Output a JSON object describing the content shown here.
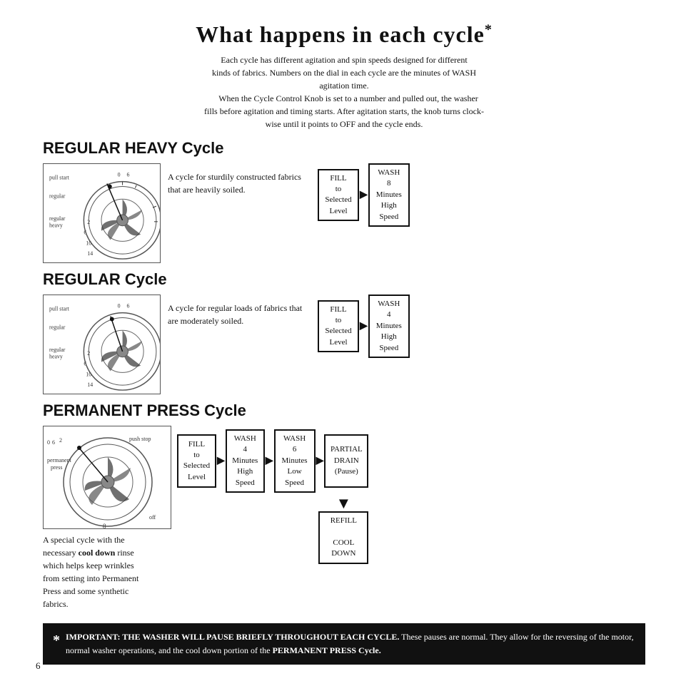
{
  "page": {
    "title": "What happens in each cycle",
    "title_sup": "*",
    "intro": [
      "Each cycle has different agitation and spin speeds designed for different",
      "kinds of fabrics. Numbers on the dial in each cycle are the minutes of WASH",
      "agitation time.",
      "When the Cycle Control Knob is set to a number and pulled out, the washer",
      "fills before agitation and timing starts. After agitation starts, the knob turns clock-",
      "wise until it points to OFF and the cycle ends."
    ],
    "page_number": "6"
  },
  "cycles": [
    {
      "id": "regular-heavy",
      "title": "REGULAR HEAVY Cycle",
      "description": "A cycle for sturdily constructed fabrics that are heavily soiled.",
      "flow": [
        {
          "label": "FILL\nto\nSelected\nLevel"
        },
        {
          "arrow": true
        },
        {
          "label": "WASH\n8\nMinutes\nHigh\nSpeed"
        }
      ]
    },
    {
      "id": "regular",
      "title": "REGULAR Cycle",
      "description": "A cycle for regular loads of fabrics that are moderately soiled.",
      "flow": [
        {
          "label": "FILL\nto\nSelected\nLevel"
        },
        {
          "arrow": true
        },
        {
          "label": "WASH\n4\nMinutes\nHigh\nSpeed"
        }
      ]
    }
  ],
  "perm_press": {
    "title": "PERMANENT PRESS Cycle",
    "description": "A special cycle with the necessary cool down rinse which helps keep wrinkles from setting into Permanent Press and some synthetic fabrics.",
    "description_bold": "cool down",
    "flow_top": [
      {
        "label": "FILL\nto\nSelected\nLevel"
      },
      {
        "arrow": true
      },
      {
        "label": "WASH\n4\nMinutes\nHigh\nSpeed"
      },
      {
        "arrow": true
      },
      {
        "label": "WASH\n6\nMinutes\nLow\nSpeed"
      },
      {
        "arrow": true
      },
      {
        "label": "PARTIAL\nDRAIN\n(Pause)"
      }
    ],
    "flow_bottom": {
      "label": "REFILL\n\nCOOL\nDOWN"
    }
  },
  "important": {
    "asterisk": "*",
    "text_bold": "IMPORTANT: THE WASHER WILL PAUSE BRIEFLY THROUGHOUT EACH CYCLE.",
    "text_normal": " These pauses are normal. They allow for the reversing of the motor, normal washer operations, and the cool down portion of the PERMANENT PRESS Cycle."
  },
  "labels": {
    "fill_to": "FILL\nto",
    "selected_level": "Selected\nLevel",
    "wash_8_high": "WASH\n8\nMinutes\nHigh\nSpeed",
    "wash_4_high": "WASH\n4\nMinutes\nHigh\nSpeed",
    "wash_4_high_pp": "WASH\n4\nMinutes\nHigh\nSpeed",
    "wash_6_low": "WASH\n6\nMinutes\nLow\nSpeed",
    "partial_drain": "PARTIAL\nDRAIN\n(Pause)",
    "refill_cool": "REFILL\n\nCOOL\nDOWN"
  }
}
